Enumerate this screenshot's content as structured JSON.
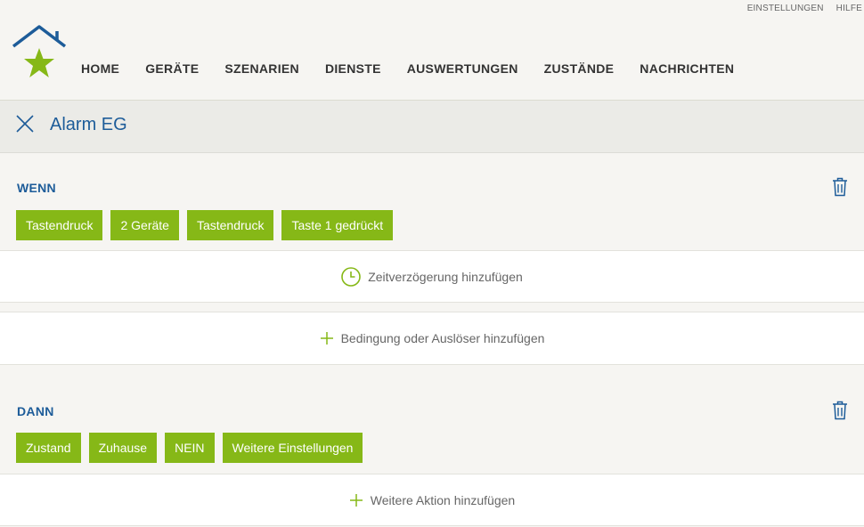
{
  "top_links": {
    "settings": "EINSTELLUNGEN",
    "help": "HILFE"
  },
  "nav": {
    "items": [
      "HOME",
      "GERÄTE",
      "SZENARIEN",
      "DIENSTE",
      "AUSWERTUNGEN",
      "ZUSTÄNDE",
      "NACHRICHTEN"
    ]
  },
  "page": {
    "title": "Alarm EG"
  },
  "when": {
    "heading": "WENN",
    "chips": [
      "Tastendruck",
      "2 Geräte",
      "Tastendruck",
      "Taste 1 gedrückt"
    ],
    "add_delay": "Zeitverzögerung hinzufügen"
  },
  "add_condition": "Bedingung oder Auslöser hinzufügen",
  "then": {
    "heading": "DANN",
    "chips": [
      "Zustand",
      "Zuhause",
      "NEIN",
      "Weitere Einstellungen"
    ],
    "add_action": "Weitere Aktion hinzufügen"
  },
  "colors": {
    "accent_blue": "#1d5c99",
    "chip_green": "#86b817",
    "star_green": "#86b817",
    "background": "#f6f5f2"
  },
  "icons": [
    "house-star-logo",
    "close-icon",
    "trash-icon",
    "clock-icon",
    "plus-icon"
  ]
}
